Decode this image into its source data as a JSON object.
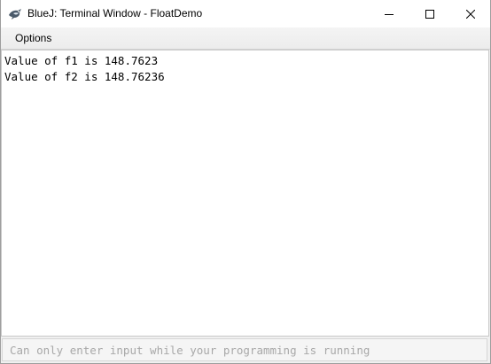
{
  "window": {
    "title": "BlueJ: Terminal Window - FloatDemo",
    "app_icon": "bluej-bird-icon",
    "controls": {
      "minimize_icon": "minimize-icon",
      "maximize_icon": "maximize-icon",
      "close_icon": "close-icon"
    }
  },
  "menubar": {
    "items": [
      {
        "label": "Options"
      }
    ]
  },
  "terminal": {
    "lines": [
      "Value of f1 is 148.7623",
      "Value of f2 is 148.76236"
    ]
  },
  "input": {
    "value": "",
    "placeholder": "Can only enter input while your programming is running"
  }
}
